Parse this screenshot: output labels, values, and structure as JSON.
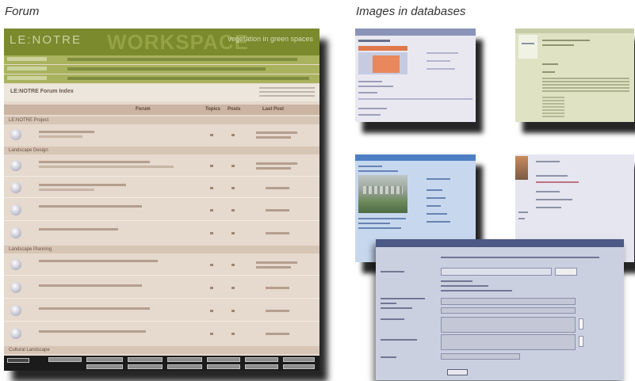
{
  "captions": {
    "forum": "Forum",
    "images": "Images in databases"
  },
  "forum": {
    "logo": "LE:NOTRE",
    "watermark": "WORKSPACE",
    "site_tagline": "vegetation in green spaces",
    "page_title": "LE:NOTRE Forum Index",
    "columns": [
      "Forum",
      "Topics",
      "Posts",
      "Last Post"
    ],
    "categories": [
      "LE:NOTRE Project",
      "Landscape Design",
      "Landscape Planning",
      "Cultural Landscape"
    ],
    "colors": {
      "banner": "#7a8a2c",
      "nav": "#a9b35d",
      "body": "#e6d9cd",
      "header": "#cbb4a2"
    }
  },
  "databases": {
    "colors": {
      "db1": "#e9e8f1",
      "db2": "#dfe3c4",
      "db3": "#c7d8ee",
      "db4": "#e5e6f0",
      "db5": "#cbd0e1"
    }
  }
}
